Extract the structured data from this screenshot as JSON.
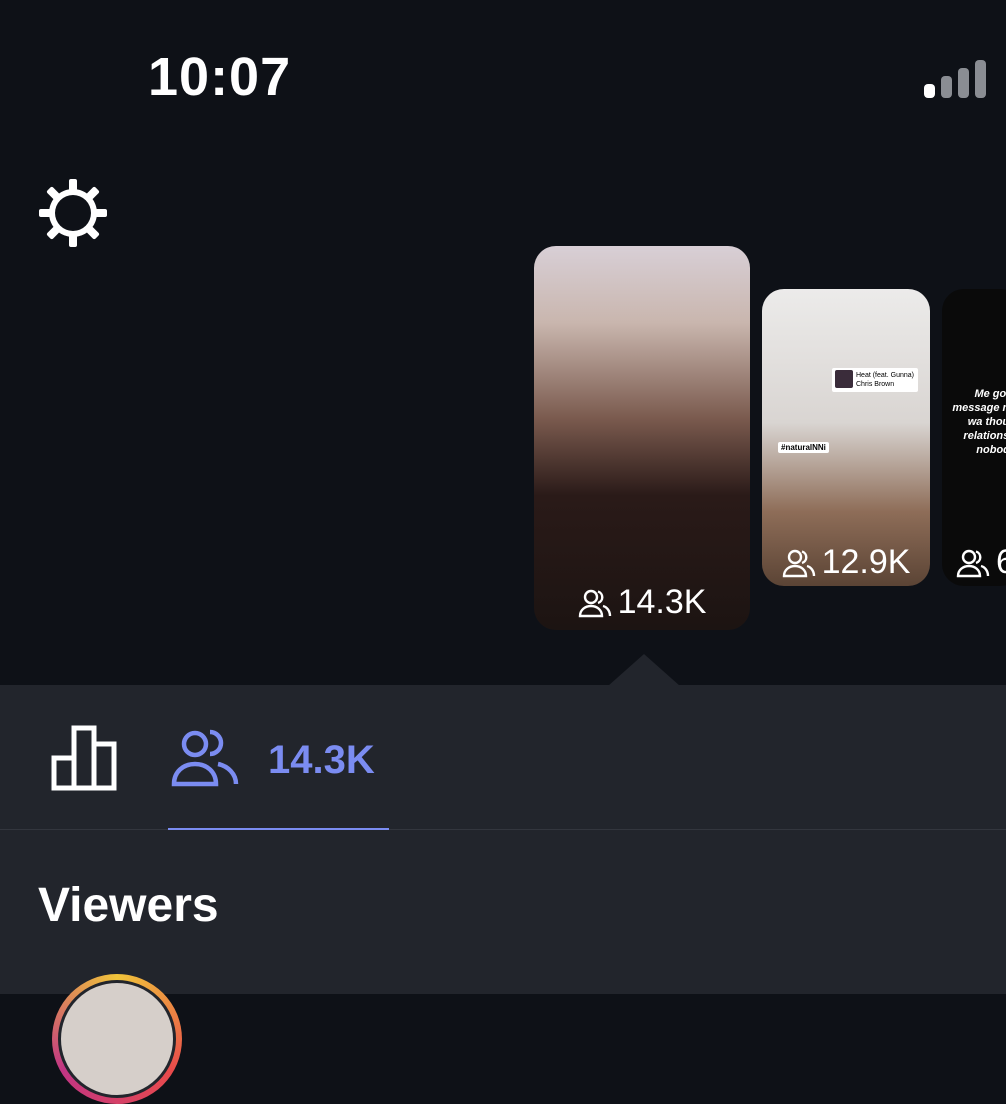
{
  "status_bar": {
    "time": "10:07"
  },
  "stories": [
    {
      "viewers": "14.3K"
    },
    {
      "viewers": "12.9K",
      "music_title": "Heat (feat. Gunna)",
      "music_artist": "Chris Brown",
      "hashtag": "#naturalNNi"
    },
    {
      "viewers": "6",
      "text": "Me goin message no wa thoug relationsh nobody"
    }
  ],
  "tabs": {
    "viewers_count": "14.3K"
  },
  "section_title": "Viewers",
  "colors": {
    "accent": "#7b8cf1",
    "background": "#0e1117",
    "panel": "#22252c"
  }
}
